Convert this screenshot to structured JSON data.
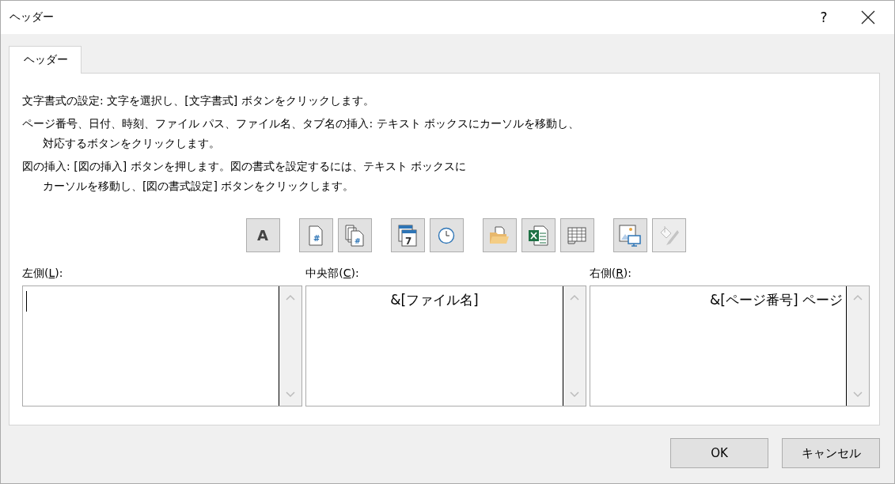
{
  "window": {
    "title": "ヘッダー",
    "help": "?"
  },
  "tabs": [
    {
      "label": "ヘッダー",
      "selected": true
    }
  ],
  "instructions": [
    {
      "lines": [
        "文字書式の設定: 文字を選択し、[文字書式] ボタンをクリックします。"
      ]
    },
    {
      "lines": [
        "ページ番号、日付、時刻、ファイル パス、ファイル名、タブ名の挿入: テキスト ボックスにカーソルを移動し、",
        "対応するボタンをクリックします。"
      ]
    },
    {
      "lines": [
        "図の挿入: [図の挿入] ボタンを押します。図の書式を設定するには、テキスト ボックスに",
        "カーソルを移動し、[図の書式設定] ボタンをクリックします。"
      ]
    }
  ],
  "toolbar_groups": [
    [
      {
        "kind": "font",
        "text": "A",
        "disabled": false
      }
    ],
    [
      {
        "kind": "page",
        "glyph": "#",
        "disabled": false
      },
      {
        "kind": "pages",
        "glyph": "#",
        "disabled": false
      }
    ],
    [
      {
        "kind": "calendar",
        "glyph": "7",
        "disabled": false
      },
      {
        "kind": "clock",
        "disabled": false
      }
    ],
    [
      {
        "kind": "folder",
        "disabled": false
      },
      {
        "kind": "workbook",
        "disabled": false
      },
      {
        "kind": "grid",
        "disabled": false
      }
    ],
    [
      {
        "kind": "picture",
        "disabled": false
      },
      {
        "kind": "paint",
        "disabled": true
      }
    ]
  ],
  "sections": [
    {
      "label_before": "左側(",
      "access_key": "L",
      "label_after": "):",
      "focused": true
    },
    {
      "label_before": "中央部(",
      "access_key": "C",
      "label_after": "):",
      "value": "&[ファイル名]",
      "focused": false
    },
    {
      "label_before": "右側(",
      "access_key": "R",
      "label_after": "):",
      "value": "&[ページ番号] ページ",
      "focused": false
    }
  ],
  "buttons": [
    {
      "label": "OK"
    },
    {
      "label": "キャンセル"
    }
  ]
}
